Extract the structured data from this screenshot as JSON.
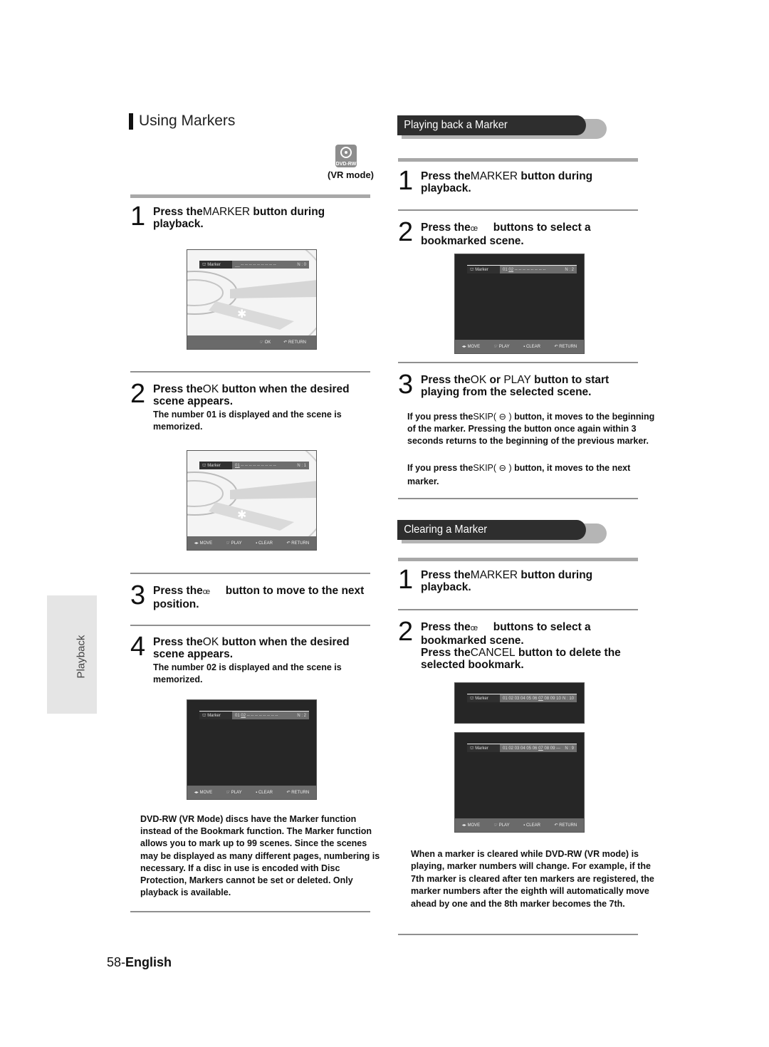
{
  "page": {
    "title": "Using Markers",
    "disc_badge": "DVD-RW",
    "mode_label": "(VR mode)",
    "side_tab": "Playback",
    "page_number": "58-",
    "language": "English"
  },
  "left_steps": [
    {
      "num": "1",
      "pre": "Press the",
      "key": "MARKER",
      "post": " button during playback.",
      "sub": ""
    },
    {
      "num": "2",
      "pre": "Press the",
      "key": "OK",
      "post": " button when the desired scene appears.",
      "sub": "The number 01 is displayed and the scene is memorized."
    },
    {
      "num": "3",
      "pre": "Press the",
      "key": "œ",
      "post": "     button to move to the next position.",
      "sub": ""
    },
    {
      "num": "4",
      "pre": "Press the",
      "key": "OK",
      "post": " button when the desired scene appears.",
      "sub": "The number 02 is displayed and the scene is memorized."
    }
  ],
  "left_note": "DVD-RW (VR Mode) discs have the Marker function instead of the Bookmark function. The Marker function allows you to mark up to 99 scenes. Since the scenes may be displayed as many different pages, numbering is necessary. If a disc in use is encoded with Disc Protection, Markers cannot be set or deleted. Only playback is available.",
  "screens": {
    "s1": {
      "title": "Marker",
      "values": "__ -- -- -- -- -- -- -- -- --",
      "count": "N : 0",
      "footer": [
        "OK",
        "RETURN"
      ]
    },
    "s2": {
      "title": "Marker",
      "sel": "01",
      "values": "-- -- -- -- -- -- -- -- --",
      "count": "N : 1",
      "footer": [
        "MOVE",
        "PLAY",
        "CLEAR",
        "RETURN"
      ]
    },
    "s3": {
      "title": "Marker",
      "first": "01",
      "sel": "02",
      "values": "-- -- -- -- -- -- -- --",
      "count": "N : 2",
      "footer": [
        "MOVE",
        "PLAY",
        "CLEAR",
        "RETURN"
      ]
    },
    "s4": {
      "title": "Marker",
      "first": "01",
      "sel": "02",
      "values": "-- -- -- -- -- -- -- --",
      "count": "N : 2",
      "footer": [
        "MOVE",
        "PLAY",
        "CLEAR",
        "RETURN"
      ]
    },
    "s5": {
      "title": "Marker",
      "pre": "01 02 03 04 05 06",
      "sel": "07",
      "post": "08 09 10",
      "count": "N : 10"
    },
    "s6": {
      "title": "Marker",
      "pre": "01 02 03 04 05 06",
      "sel": "07",
      "post": "08 09 ---",
      "count": "N : 9",
      "footer": [
        "MOVE",
        "PLAY",
        "CLEAR",
        "RETURN"
      ]
    }
  },
  "playback_section": {
    "header": "Playing back a Marker",
    "steps": [
      {
        "num": "1",
        "pre": "Press the",
        "key": "MARKER",
        "post": " button during playback."
      },
      {
        "num": "2",
        "pre": "Press the",
        "key": "œ",
        "post": "     buttons to select a bookmarked scene."
      },
      {
        "num": "3",
        "pre": "Press the",
        "key": "OK",
        "mid": " or ",
        "key2": "PLAY",
        "post": " button to start playing from the selected scene."
      }
    ],
    "notes": [
      {
        "pre": "If you press the",
        "key": "SKIP( ⊖ )",
        "post": " button, it moves to the beginning of the marker. Pressing the button once again within 3 seconds returns to the beginning of the previous marker."
      },
      {
        "pre": "If you press the",
        "key": "SKIP( ⊖ )",
        "post": " button, it moves to the next marker."
      }
    ]
  },
  "clearing_section": {
    "header": "Clearing a Marker",
    "steps": [
      {
        "num": "1",
        "pre": "Press the",
        "key": "MARKER",
        "post": " button during playback."
      },
      {
        "num": "2",
        "pre": "Press the",
        "key": "œ",
        "post": "     buttons to select a bookmarked scene.",
        "pre2": "Press the",
        "key2": "CANCEL",
        "post2": " button to delete the selected bookmark."
      }
    ],
    "note": "When a marker is cleared while DVD-RW (VR mode) is playing, marker numbers will change. For example, if the 7th marker is cleared after ten markers are registered, the marker numbers after the eighth will automatically move ahead by one and the 8th marker becomes the 7th."
  }
}
